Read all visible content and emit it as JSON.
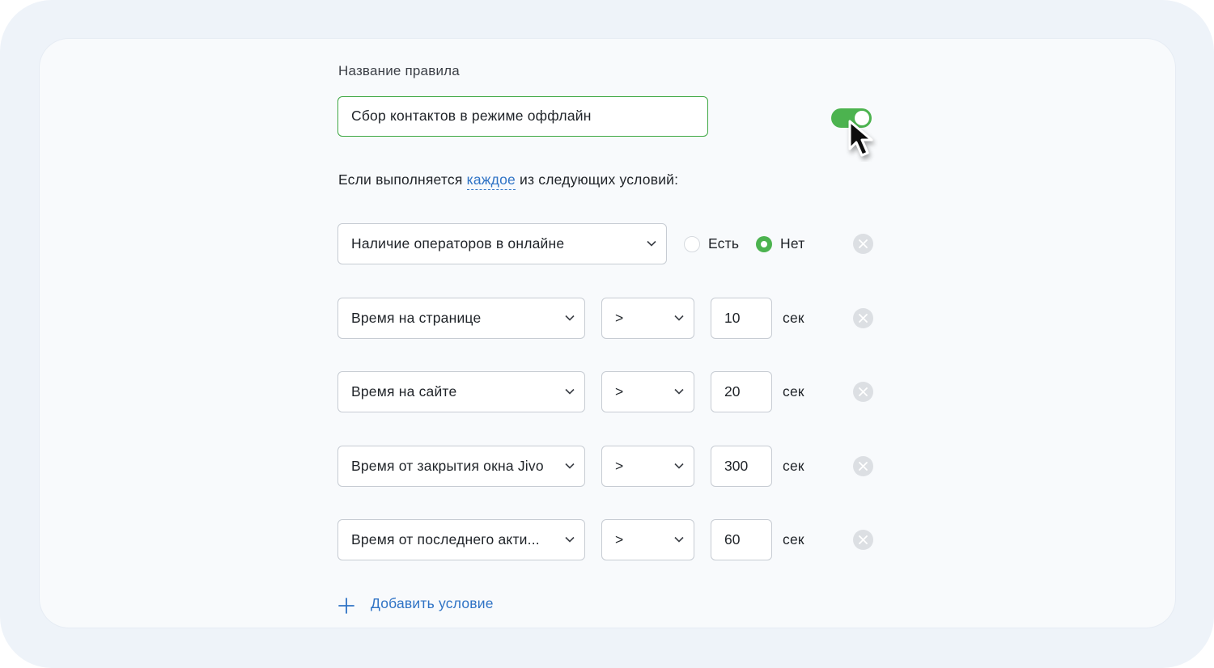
{
  "rule": {
    "label": "Название правила",
    "name_value": "Сбор контактов в режиме оффлайн",
    "enabled": true
  },
  "condition_header": {
    "prefix": "Если выполняется",
    "mode_link": "каждое",
    "suffix": "из следующих условий:"
  },
  "conditions": [
    {
      "field": "Наличие операторов в онлайне",
      "options": [
        "Есть",
        "Нет"
      ],
      "selected": "Нет"
    },
    {
      "field": "Время на странице",
      "operator": ">",
      "value": "10",
      "unit": "сек"
    },
    {
      "field": "Время на сайте",
      "operator": ">",
      "value": "20",
      "unit": "сек"
    },
    {
      "field": "Время от закрытия окна Jivo",
      "operator": ">",
      "value": "300",
      "unit": "сек"
    },
    {
      "field": "Время от последнего акти...",
      "operator": ">",
      "value": "60",
      "unit": "сек"
    }
  ],
  "add_condition_label": "Добавить условие",
  "colors": {
    "accent_green": "#4cb34f",
    "link_blue": "#2f73c5",
    "input_border_active": "#3fa844"
  },
  "icons": {
    "select_arrow": "chevron-down-icon",
    "remove": "close-circle-icon",
    "add": "plus-icon",
    "pointer": "cursor-arrow-icon"
  }
}
